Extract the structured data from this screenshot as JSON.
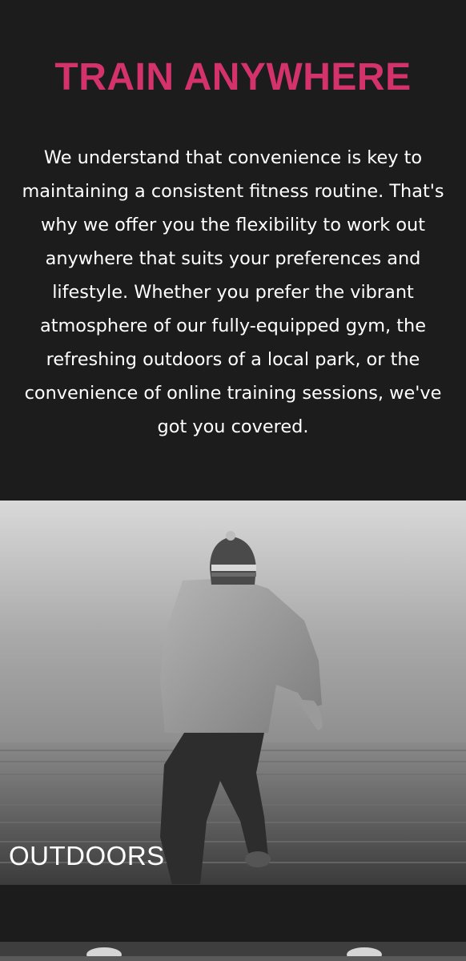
{
  "section": {
    "title": "TRAIN ANYWHERE",
    "description": "We understand that convenience is key to maintaining a consistent fitness routine. That's why we offer you the flexibility to work out anywhere that suits your preferences and lifestyle. Whether you prefer the vibrant atmosphere of our fully-equipped gym, the refreshing outdoors of a local park, or the convenience of online training sessions, we've got you covered."
  },
  "cards": [
    {
      "label": "OUTDOORS",
      "image": "man-running-up-stairs-photo"
    }
  ],
  "colors": {
    "background": "#1c1c1d",
    "accent": "#d3336a",
    "text": "#ffffff"
  }
}
